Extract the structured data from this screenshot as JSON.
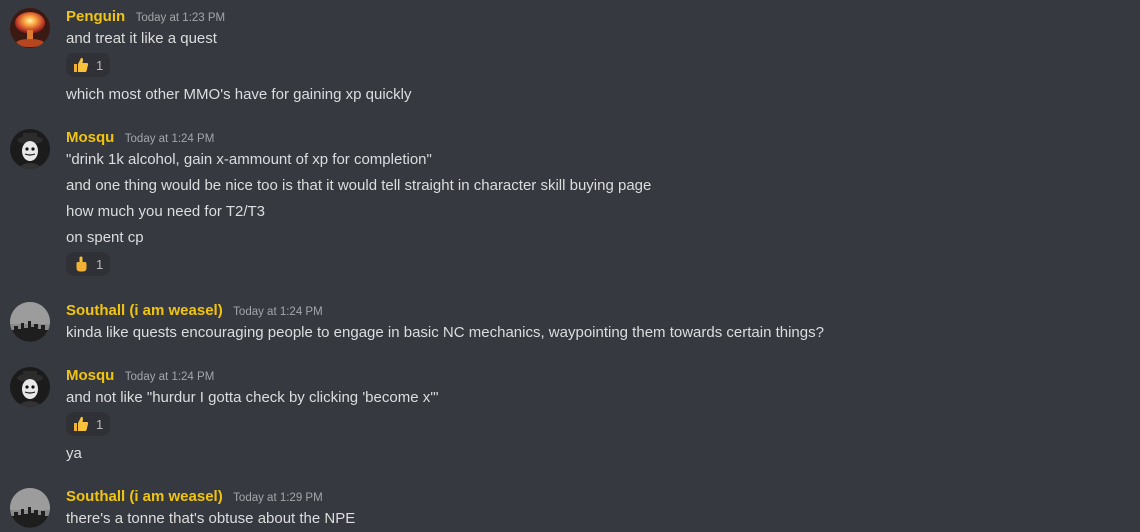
{
  "colors": {
    "background": "#36393f",
    "username": "#f1c40f",
    "message_text": "#dcddde",
    "timestamp": "#a3a6aa",
    "reaction_bg": "#2f3136"
  },
  "groups": [
    {
      "username": "Penguin",
      "timestamp": "Today at 1:23 PM",
      "avatar_icon": "mushroom-cloud-avatar",
      "messages": [
        "and treat it like a quest",
        "which most other MMO's have for gaining xp quickly"
      ],
      "reactions": [
        {
          "emoji": "thumbs-up-icon",
          "count": "1"
        }
      ]
    },
    {
      "username": "Mosqu",
      "timestamp": "Today at 1:24 PM",
      "avatar_icon": "masked-figure-avatar",
      "messages": [
        "\"drink 1k alcohol, gain x-ammount of xp for completion\"",
        "and one thing would be nice too is that it would tell straight in character skill buying page",
        "how much you need for T2/T3",
        "on spent cp"
      ],
      "reactions": [
        {
          "emoji": "pointing-up-icon",
          "count": "1"
        }
      ]
    },
    {
      "username": "Southall (i am weasel)",
      "timestamp": "Today at 1:24 PM",
      "avatar_icon": "city-skyline-avatar",
      "messages": [
        "kinda like quests encouraging people to engage in basic NC mechanics, waypointing them towards certain things?"
      ],
      "reactions": []
    },
    {
      "username": "Mosqu",
      "timestamp": "Today at 1:24 PM",
      "avatar_icon": "masked-figure-avatar",
      "messages": [
        "and not like \"hurdur I gotta check by clicking 'become x'\"",
        "ya"
      ],
      "reactions": [
        {
          "emoji": "thumbs-up-icon",
          "count": "1"
        }
      ]
    },
    {
      "username": "Southall (i am weasel)",
      "timestamp": "Today at 1:29 PM",
      "avatar_icon": "city-skyline-avatar",
      "messages": [
        "there's a tonne that's obtuse about the NPE"
      ],
      "reactions": []
    }
  ]
}
